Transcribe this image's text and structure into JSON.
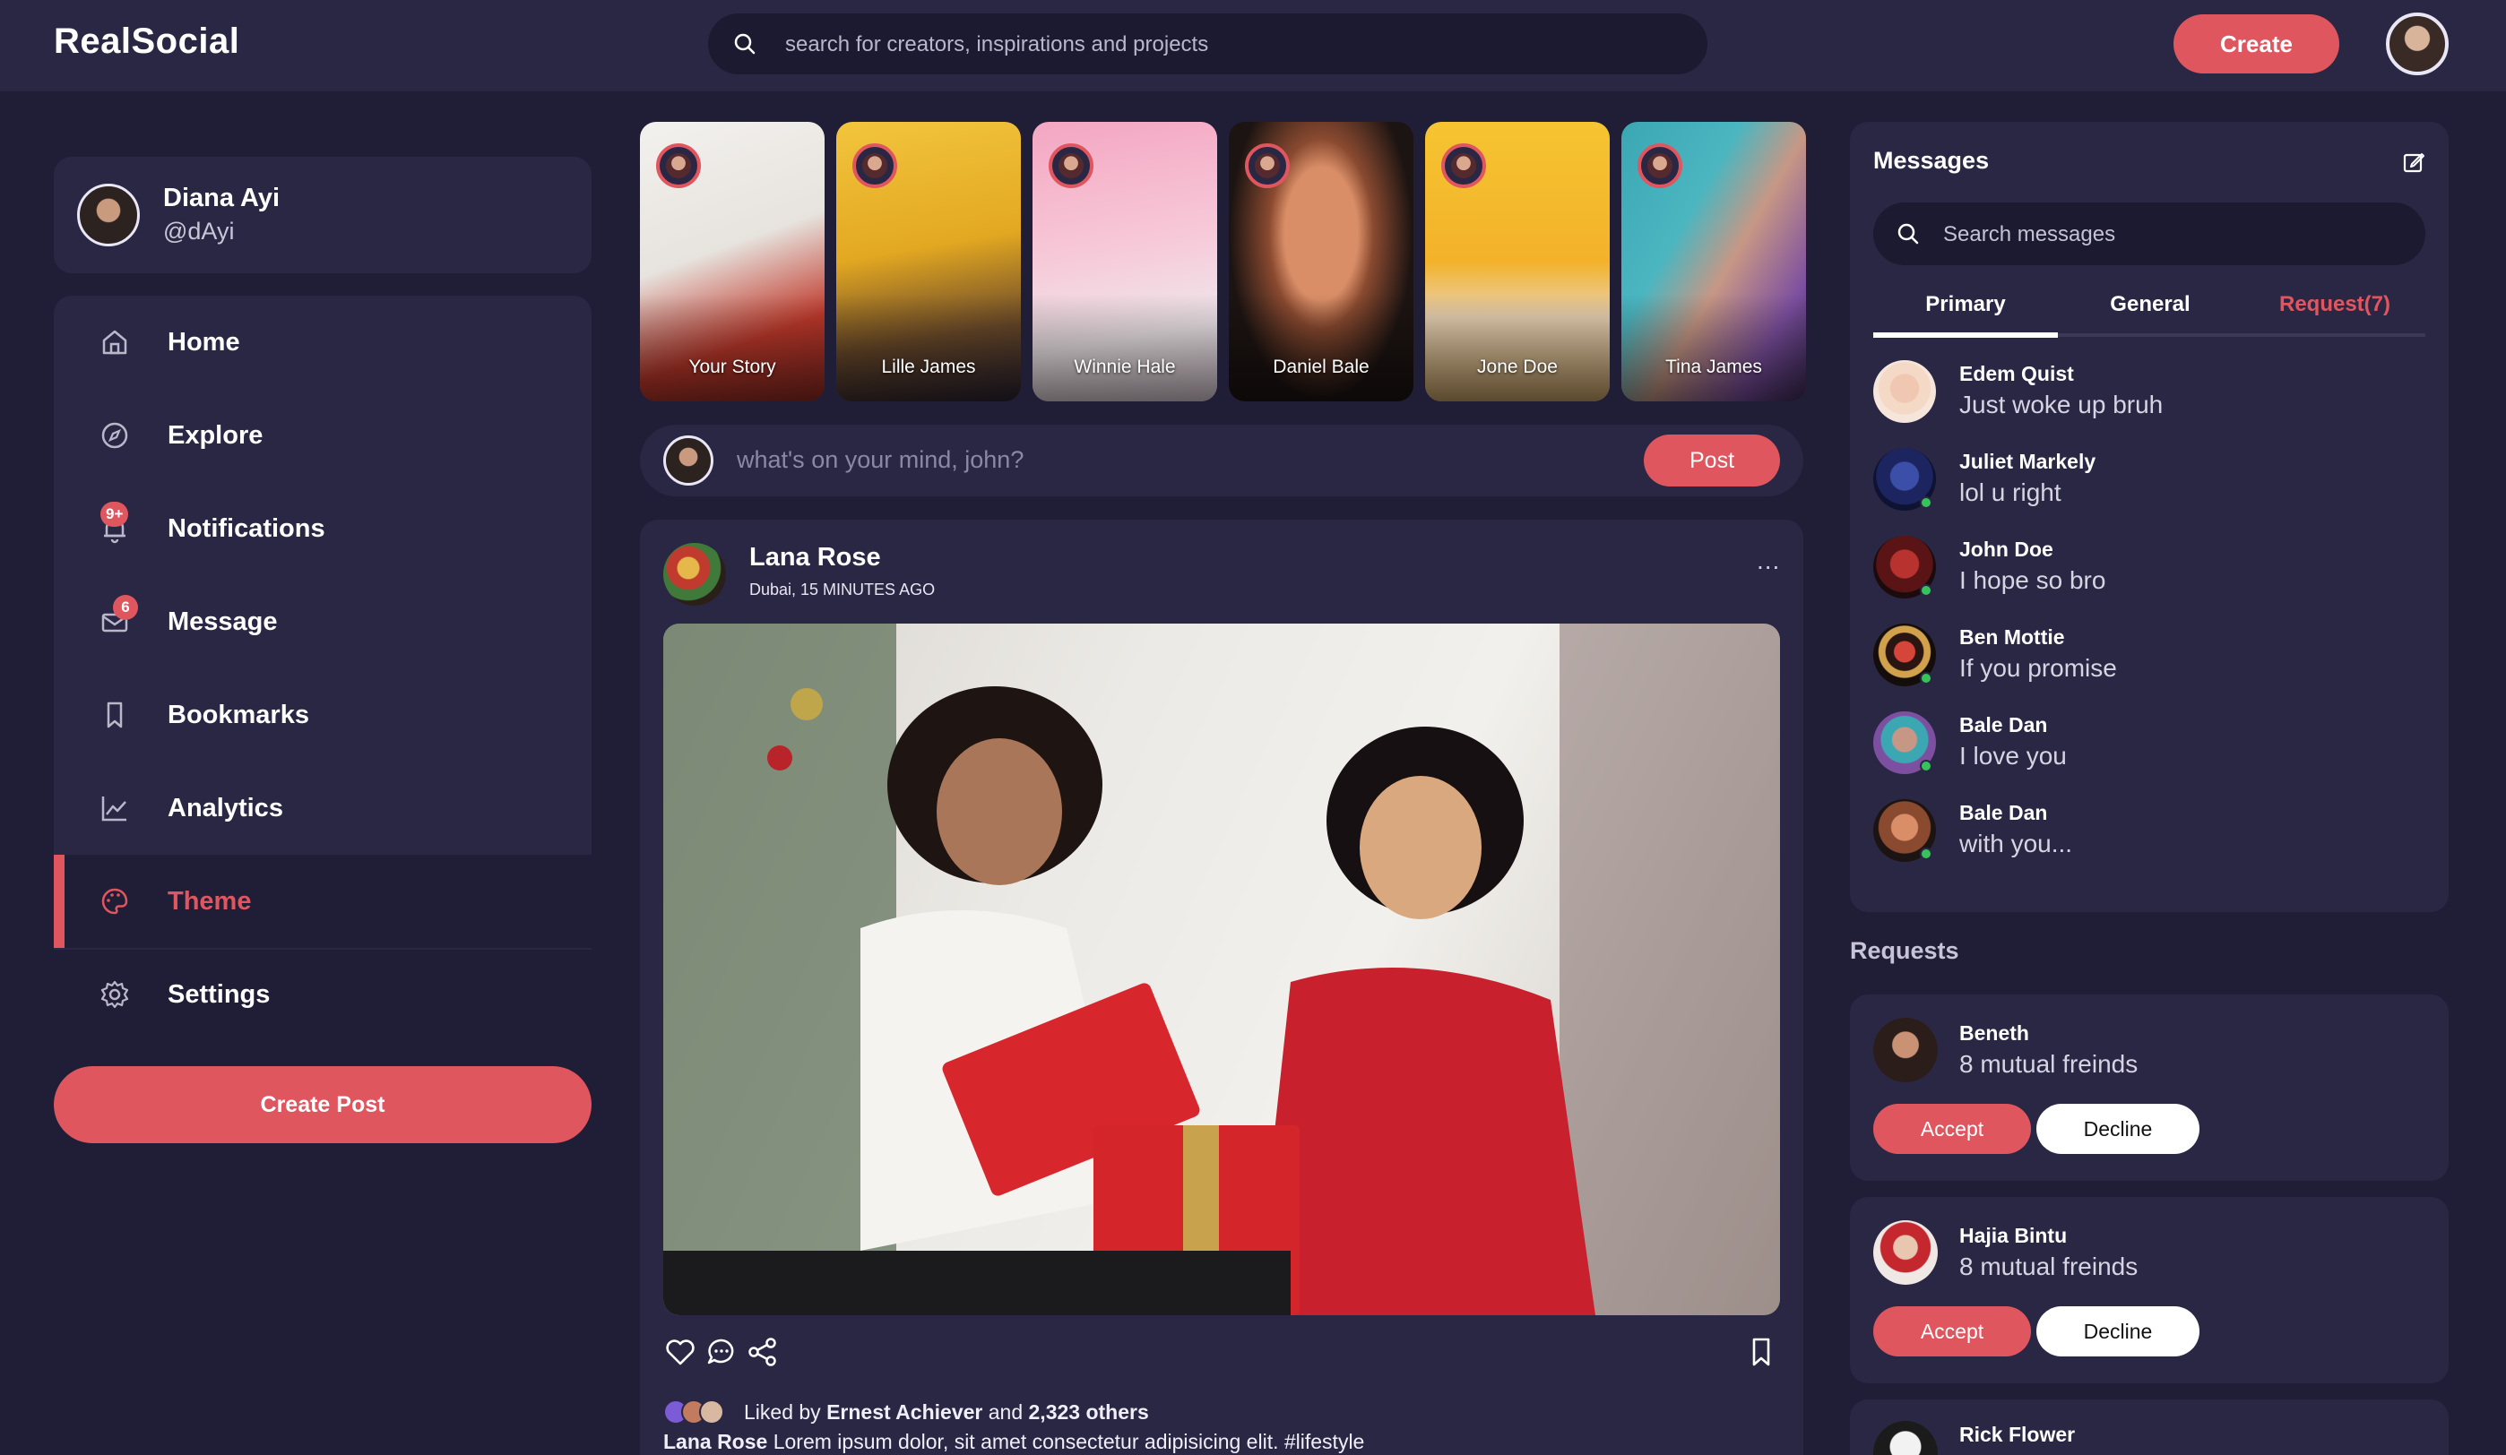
{
  "app": {
    "name": "RealSocial"
  },
  "search": {
    "placeholder": "search for creators, inspirations and projects"
  },
  "header": {
    "create_label": "Create"
  },
  "profile": {
    "name": "Diana Ayi",
    "handle": "@dAyi"
  },
  "nav": {
    "items": [
      {
        "label": "Home",
        "icon": "home-icon"
      },
      {
        "label": "Explore",
        "icon": "compass-icon"
      },
      {
        "label": "Notifications",
        "icon": "bell-icon",
        "badge": "9+"
      },
      {
        "label": "Message",
        "icon": "mail-icon",
        "badge": "6"
      },
      {
        "label": "Bookmarks",
        "icon": "bookmark-icon"
      },
      {
        "label": "Analytics",
        "icon": "chart-icon"
      },
      {
        "label": "Theme",
        "icon": "palette-icon",
        "active": true
      },
      {
        "label": "Settings",
        "icon": "gear-icon"
      }
    ],
    "create_post_label": "Create Post"
  },
  "stories": [
    {
      "name": "Your Story"
    },
    {
      "name": "Lille James"
    },
    {
      "name": "Winnie Hale"
    },
    {
      "name": "Daniel Bale"
    },
    {
      "name": "Jone Doe"
    },
    {
      "name": "Tina James"
    }
  ],
  "composer": {
    "placeholder": "what's on your mind, john?",
    "post_label": "Post"
  },
  "feed": {
    "author": "Lana Rose",
    "location": "Dubai, 15 MINUTES AGO",
    "more": "...",
    "liked_by_prefix": "Liked by",
    "liked_by_name": "Ernest Achiever",
    "liked_by_and": "and",
    "liked_by_others": "2,323 others",
    "caption_author": "Lana Rose",
    "caption_text": "Lorem ipsum dolor, sit amet consectetur adipisicing elit. #lifestyle"
  },
  "messages": {
    "title": "Messages",
    "search_placeholder": "Search messages",
    "tabs": [
      {
        "label": "Primary",
        "active": true
      },
      {
        "label": "General"
      },
      {
        "label": "Request(7)"
      }
    ],
    "items": [
      {
        "name": "Edem Quist",
        "text": "Just woke up bruh",
        "online": false
      },
      {
        "name": "Juliet Markely",
        "text": "lol u right",
        "online": true
      },
      {
        "name": "John Doe",
        "text": "I hope so bro",
        "online": true
      },
      {
        "name": "Ben Mottie",
        "text": "If you promise",
        "online": true
      },
      {
        "name": "Bale Dan",
        "text": "I love you",
        "online": true
      },
      {
        "name": "Bale Dan",
        "text": "with you...",
        "online": true
      }
    ]
  },
  "requests": {
    "title": "Requests",
    "items": [
      {
        "name": "Beneth",
        "mutual": "8 mutual freinds",
        "accept": "Accept",
        "decline": "Decline"
      },
      {
        "name": "Hajia Bintu",
        "mutual": "8 mutual freinds",
        "accept": "Accept",
        "decline": "Decline"
      },
      {
        "name": "Rick Flower"
      }
    ]
  },
  "colors": {
    "accent": "#e0565f",
    "background": "#201d36",
    "card": "#2a2744",
    "online": "#36c45a"
  }
}
